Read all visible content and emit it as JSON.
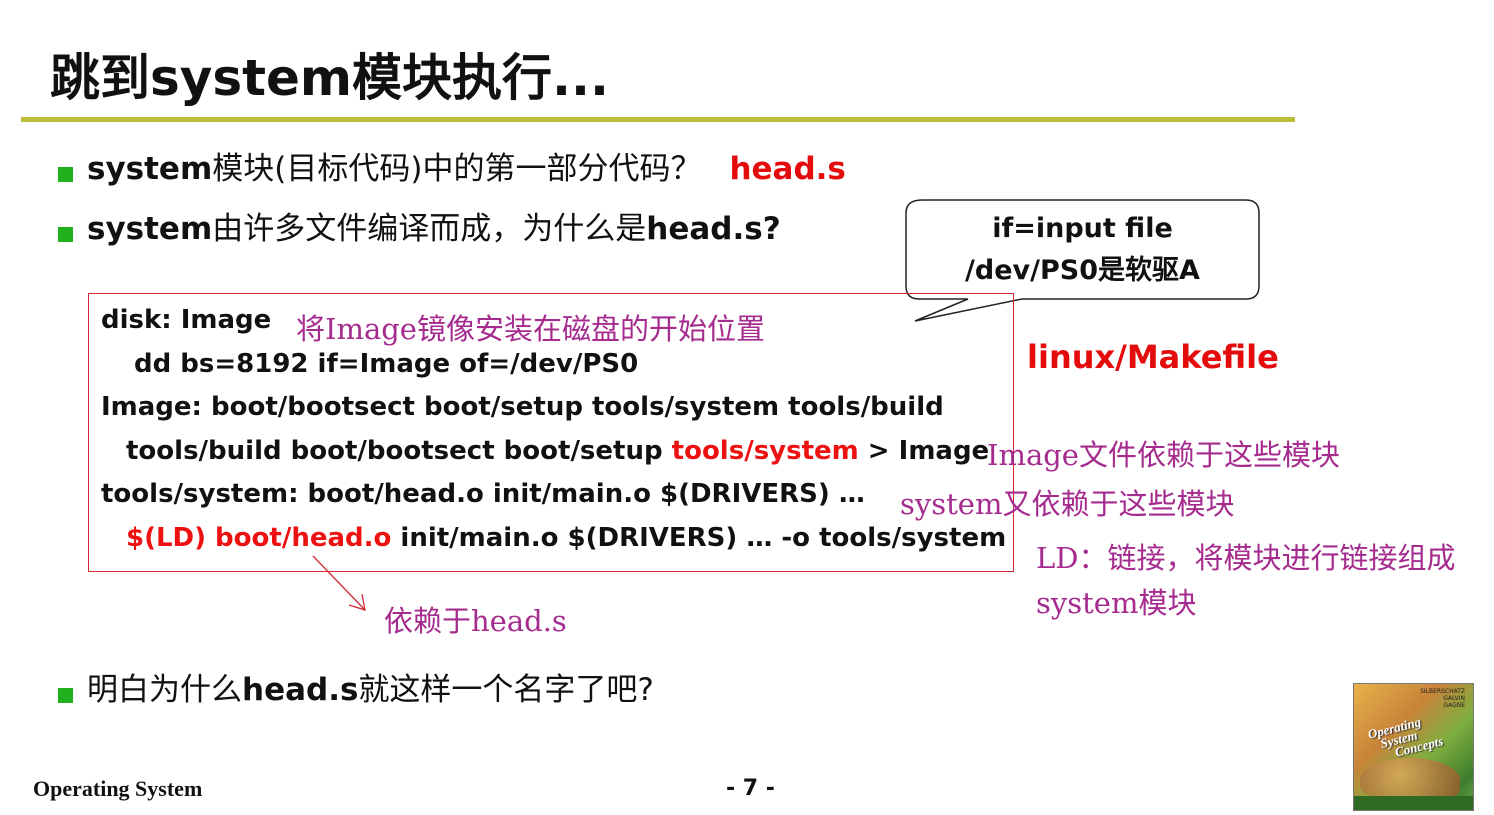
{
  "slide": {
    "title": "跳到system模块执行...",
    "bullets": {
      "b1_eng": "system",
      "b1_text": "模块(目标代码)中的第一部分代码？",
      "b1_answer": "head.s",
      "b2_eng": "system",
      "b2_text": "由许多文件编译而成，为什么是",
      "b2_eng2": "head.s?",
      "b3_text": "明白为什么",
      "b3_eng": "head.s",
      "b3_text2": "就这样一个名字了吧?"
    },
    "code": {
      "l1": "disk: Image",
      "l2": "dd bs=8192 if=Image of=/dev/PS0",
      "l3": "Image: boot/bootsect  boot/setup tools/system tools/build",
      "l4_a": "tools/build boot/bootsect boot/setup ",
      "l4_red": "tools/system",
      "l4_b": " > Image",
      "l5": "tools/system: boot/head.o  init/main.o $(DRIVERS) …",
      "l6_red": "$(LD) boot/head.o",
      "l6_b": " init/main.o $(DRIVERS) … -o tools/system"
    },
    "callout": {
      "line1": "if=input file",
      "line2": "/dev/PS0是软驱A"
    },
    "notes": {
      "image_note": "将Image镜像安装在磁盘的开始位置",
      "makefile": "linux/Makefile",
      "deps1": "Image文件依赖于这些模块",
      "deps2": "system又依赖于这些模块",
      "ld1": "LD：链接，将模块进行链接组成",
      "ld2": "system模块",
      "head_dep": "依赖于head.s"
    },
    "footer": {
      "left": "Operating System",
      "page": "- 7 -"
    },
    "book": {
      "title_line1": "Operating",
      "title_line2": "System",
      "title_line3": "Concepts",
      "authors": "SILBERSCHATZ\nGALVIN\nGAGNE"
    },
    "colors": {
      "rule": "#bcbd3a",
      "bullet": "#22b11e",
      "red": "#e30b0b",
      "note": "#a52b8e",
      "box_border": "#d22a35"
    }
  }
}
